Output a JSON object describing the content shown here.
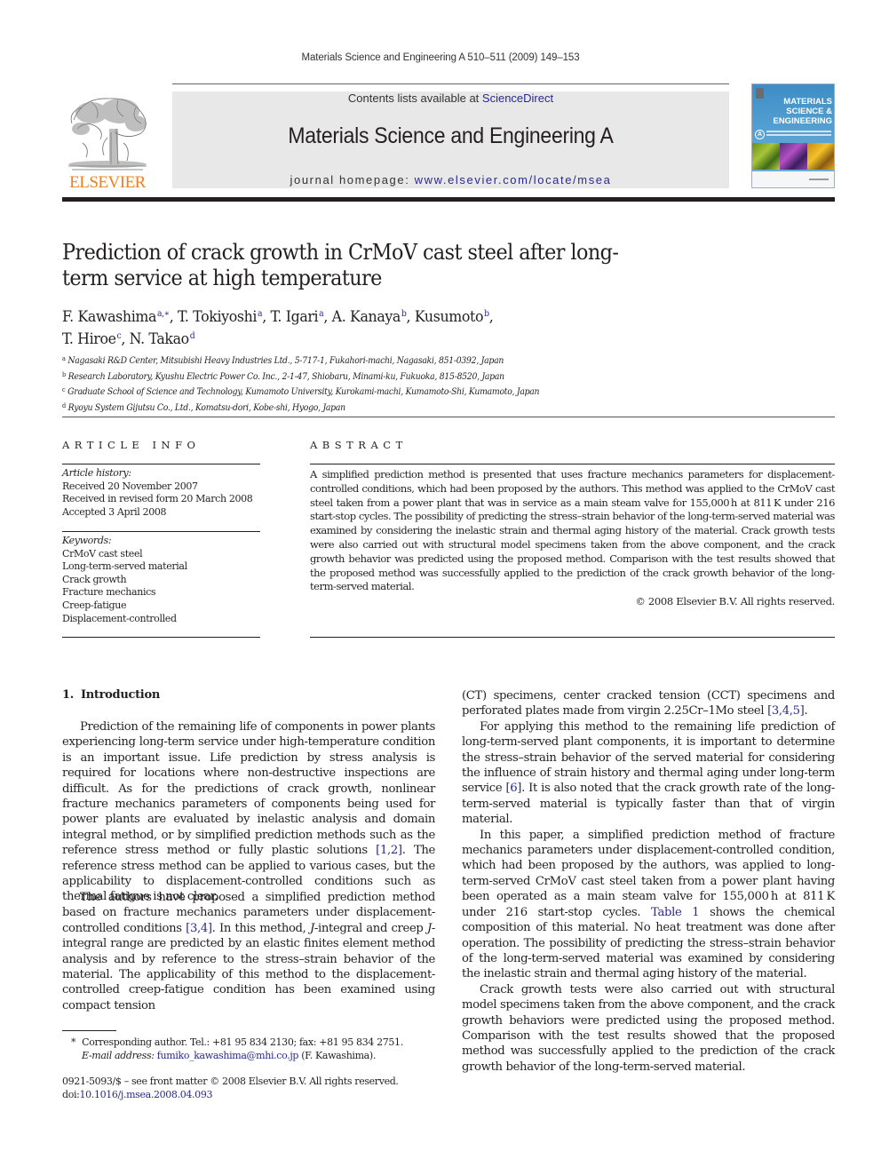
{
  "running_head": "Materials Science and Engineering A 510–511 (2009) 149–153",
  "masthead": {
    "publisher_logo_text": "ELSEVIER",
    "contents_prefix": "Contents lists available at ",
    "contents_link": "ScienceDirect",
    "journal_name": "Materials Science and Engineering A",
    "homepage_prefix": "journal homepage: ",
    "homepage_link": "www.elsevier.com/locate/msea",
    "cover": {
      "title_lines": [
        "MATERIALS",
        "SCIENCE &",
        "ENGINEERING"
      ],
      "letter": "A"
    },
    "colors": {
      "elsevier_orange": "#f07f1e",
      "link_blue": "#2a2a8c",
      "band_gray": "#e8e8e9",
      "cover_blue": "#3d8ec6"
    }
  },
  "article": {
    "title": "Prediction of crack growth in CrMoV cast steel after long-term service at high temperature",
    "authors": [
      {
        "name": "F. Kawashima",
        "aff": "a,∗",
        "sep": ", "
      },
      {
        "name": "T. Tokiyoshi",
        "aff": "a",
        "sep": ", "
      },
      {
        "name": "T. Igari",
        "aff": "a",
        "sep": ", "
      },
      {
        "name": "A. Kanaya",
        "aff": "b",
        "sep": ", "
      },
      {
        "name": "Kusumoto",
        "aff": "b",
        "sep": ","
      },
      {
        "name": "T. Hiroe",
        "aff": "c",
        "sep": ", "
      },
      {
        "name": "N. Takao",
        "aff": "d",
        "sep": ""
      }
    ],
    "affiliations": [
      {
        "key": "a",
        "text": "Nagasaki R&D Center, Mitsubishi Heavy Industries Ltd., 5-717-1, Fukahori-machi, Nagasaki, 851-0392, Japan"
      },
      {
        "key": "b",
        "text": "Research Laboratory, Kyushu Electric Power Co. Inc., 2-1-47, Shiobaru, Minami-ku, Fukuoka, 815-8520, Japan"
      },
      {
        "key": "c",
        "text": "Graduate School of Science and Technology, Kumamoto University, Kurokami-machi, Kumamoto-Shi, Kumamoto, Japan"
      },
      {
        "key": "d",
        "text": "Ryoyu System Gijutsu Co., Ltd., Komatsu-dori, Kobe-shi, Hyogo, Japan"
      }
    ]
  },
  "article_info": {
    "heading": "ARTICLE INFO",
    "history_label": "Article history:",
    "history": [
      "Received 20 November 2007",
      "Received in revised form 20 March 2008",
      "Accepted 3 April 2008"
    ],
    "keywords_label": "Keywords:",
    "keywords": [
      "CrMoV cast steel",
      "Long-term-served material",
      "Crack growth",
      "Fracture mechanics",
      "Creep-fatigue",
      "Displacement-controlled"
    ]
  },
  "abstract": {
    "heading": "ABSTRACT",
    "text": "A simplified prediction method is presented that uses fracture mechanics parameters for displacement-controlled conditions, which had been proposed by the authors. This method was applied to the CrMoV cast steel taken from a power plant that was in service as a main steam valve for 155,000 h at 811 K under 216 start-stop cycles. The possibility of predicting the stress–strain behavior of the long-term-served material was examined by considering the inelastic strain and thermal aging history of the material. Crack growth tests were also carried out with structural model specimens taken from the above component, and the crack growth behavior was predicted using the proposed method. Comparison with the test results showed that the proposed method was successfully applied to the prediction of the crack growth behavior of the long-term-served material.",
    "copyright": "© 2008 Elsevier B.V. All rights reserved."
  },
  "body": {
    "section_number": "1.",
    "section_title": "Introduction",
    "left_p1": {
      "a": "Prediction of the remaining life of components in power plants experiencing long-term service under high-temperature condition is an important issue. Life prediction by stress analysis is required for locations where non-destructive inspections are difficult. As for the predictions of crack growth, nonlinear fracture mechanics parameters of components being used for power plants are evaluated by inelastic analysis and domain integral method, or by simplified prediction methods such as the reference stress method or fully plastic solutions ",
      "ref": "[1,2]",
      "b": ". The reference stress method can be applied to various cases, but the applicability to displacement-controlled conditions such as thermal fatigue is not clear."
    },
    "left_p2": {
      "a": "The authors have proposed a simplified prediction method based on fracture mechanics parameters under displacement-controlled conditions ",
      "ref": "[3,4]",
      "b": ". In this method, ",
      "j1": "J",
      "c": "-integral and creep ",
      "j2": "J",
      "d": "-integral range are predicted by an elastic finites element method analysis and by reference to the stress–strain behavior of the material. The applicability of this method to the displacement-controlled creep-fatigue condition has been examined using compact tension"
    },
    "right_p0": {
      "a": "(CT) specimens, center cracked tension (CCT) specimens and perforated plates made from virgin 2.25Cr–1Mo steel ",
      "ref": "[3,4,5]",
      "b": "."
    },
    "right_p1": {
      "a": "For applying this method to the remaining life prediction of long-term-served plant components, it is important to determine the stress–strain behavior of the served material for considering the influence of strain history and thermal aging under long-term service ",
      "ref": "[6]",
      "b": ". It is also noted that the crack growth rate of the long-term-served material is typically faster than that of virgin material."
    },
    "right_p2": {
      "a": "In this paper, a simplified prediction method of fracture mechanics parameters under displacement-controlled condition, which had been proposed by the authors, was applied to long-term-served CrMoV cast steel taken from a power plant having been operated as a main steam valve for 155,000 h at 811 K under 216 start-stop cycles. ",
      "ref": "Table 1",
      "b": " shows the chemical composition of this material. No heat treatment was done after operation. The possibility of predicting the stress–strain behavior of the long-term-served material was examined by considering the inelastic strain and thermal aging history of the material."
    },
    "right_p3": "Crack growth tests were also carried out with structural model specimens taken from the above component, and the crack growth behaviors were predicted using the proposed method. Comparison with the test results showed that the proposed method was successfully applied to the prediction of the crack growth behavior of the long-term-served material."
  },
  "footnote": {
    "star": "*",
    "corresponding": "Corresponding author. Tel.: +81 95 834 2130; fax: +81 95 834 2751.",
    "email_label": "E-mail address:",
    "email": "fumiko_kawashima@mhi.co.jp",
    "email_suffix": " (F. Kawashima)."
  },
  "front_matter": {
    "issn_line": "0921-5093/$ – see front matter © 2008 Elsevier B.V. All rights reserved.",
    "doi_prefix": "doi:",
    "doi": "10.1016/j.msea.2008.04.093"
  }
}
